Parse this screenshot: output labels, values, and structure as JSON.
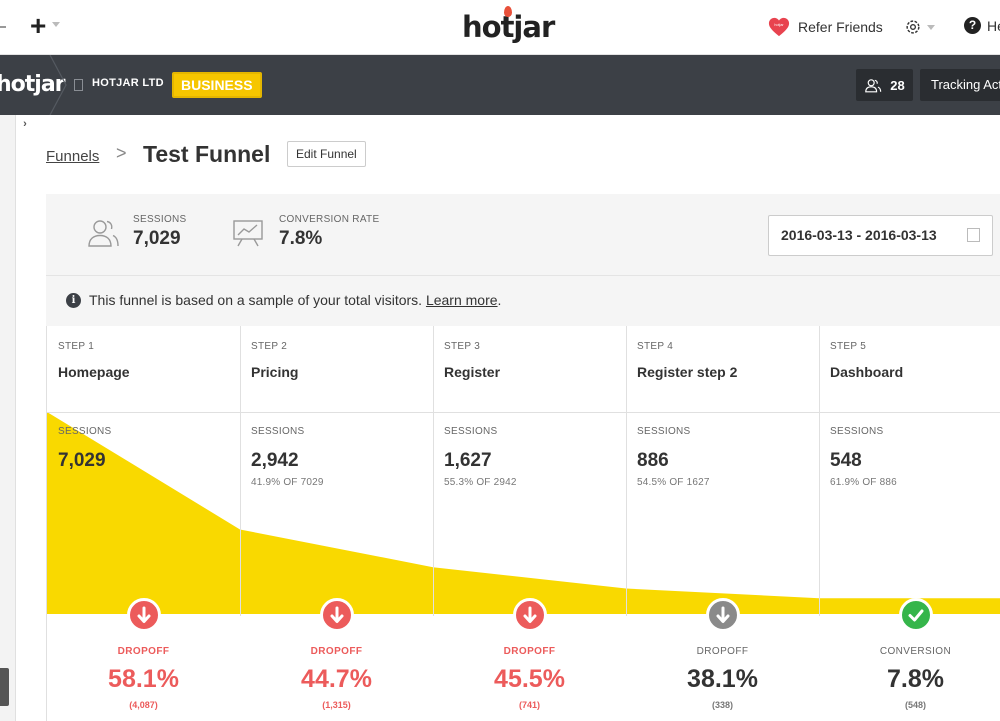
{
  "topbar": {
    "logo": "hotjar",
    "refer_label": "Refer Friends",
    "help_label": "Help"
  },
  "account": {
    "logo": "hotjar",
    "company": "HOTJAR LTD",
    "plan": "BUSINESS",
    "users_count": "28",
    "tracking_label": "Tracking Active"
  },
  "breadcrumb": {
    "parent": "Funnels",
    "separator": ">",
    "title": "Test Funnel",
    "edit_label": "Edit Funnel"
  },
  "summary": {
    "sessions_label": "SESSIONS",
    "sessions_value": "7,029",
    "conversion_label": "CONVERSION RATE",
    "conversion_value": "7.8%",
    "date_range": "2016-03-13 - 2016-03-13",
    "notice": "This funnel is based on a sample of your total visitors.",
    "notice_link": "Learn more",
    "notice_end": "."
  },
  "funnel": {
    "steps": [
      {
        "step": "STEP 1",
        "name": "Homepage",
        "sessions_label": "SESSIONS",
        "sessions": "7,029",
        "sessions_raw": 7029,
        "pct": "",
        "result_label": "DROPOFF",
        "result_value": "58.1%",
        "result_count": "(4,087)",
        "result_type": "dropoff-red"
      },
      {
        "step": "STEP 2",
        "name": "Pricing",
        "sessions_label": "SESSIONS",
        "sessions": "2,942",
        "sessions_raw": 2942,
        "pct": "41.9% OF 7029",
        "result_label": "DROPOFF",
        "result_value": "44.7%",
        "result_count": "(1,315)",
        "result_type": "dropoff-red"
      },
      {
        "step": "STEP 3",
        "name": "Register",
        "sessions_label": "SESSIONS",
        "sessions": "1,627",
        "sessions_raw": 1627,
        "pct": "55.3% OF 2942",
        "result_label": "DROPOFF",
        "result_value": "45.5%",
        "result_count": "(741)",
        "result_type": "dropoff-red"
      },
      {
        "step": "STEP 4",
        "name": "Register step 2",
        "sessions_label": "SESSIONS",
        "sessions": "886",
        "sessions_raw": 886,
        "pct": "54.5% OF 1627",
        "result_label": "DROPOFF",
        "result_value": "38.1%",
        "result_count": "(338)",
        "result_type": "dropoff-gray"
      },
      {
        "step": "STEP 5",
        "name": "Dashboard",
        "sessions_label": "SESSIONS",
        "sessions": "548",
        "sessions_raw": 548,
        "pct": "61.9% OF 886",
        "result_label": "CONVERSION",
        "result_value": "7.8%",
        "result_count": "(548)",
        "result_type": "conversion"
      }
    ]
  },
  "colors": {
    "funnel_fill": "#f9d900",
    "dropoff_red": "#ec5b5b",
    "dropoff_gray": "#8a8a8a",
    "conversion_green": "#35b54a",
    "plan_badge": "#f6c600"
  },
  "icons": {
    "add": "plus-icon",
    "refer": "heart-icon",
    "settings": "gear-icon",
    "help": "help-icon",
    "users": "users-icon",
    "calendar": "calendar-icon",
    "info": "info-icon"
  }
}
